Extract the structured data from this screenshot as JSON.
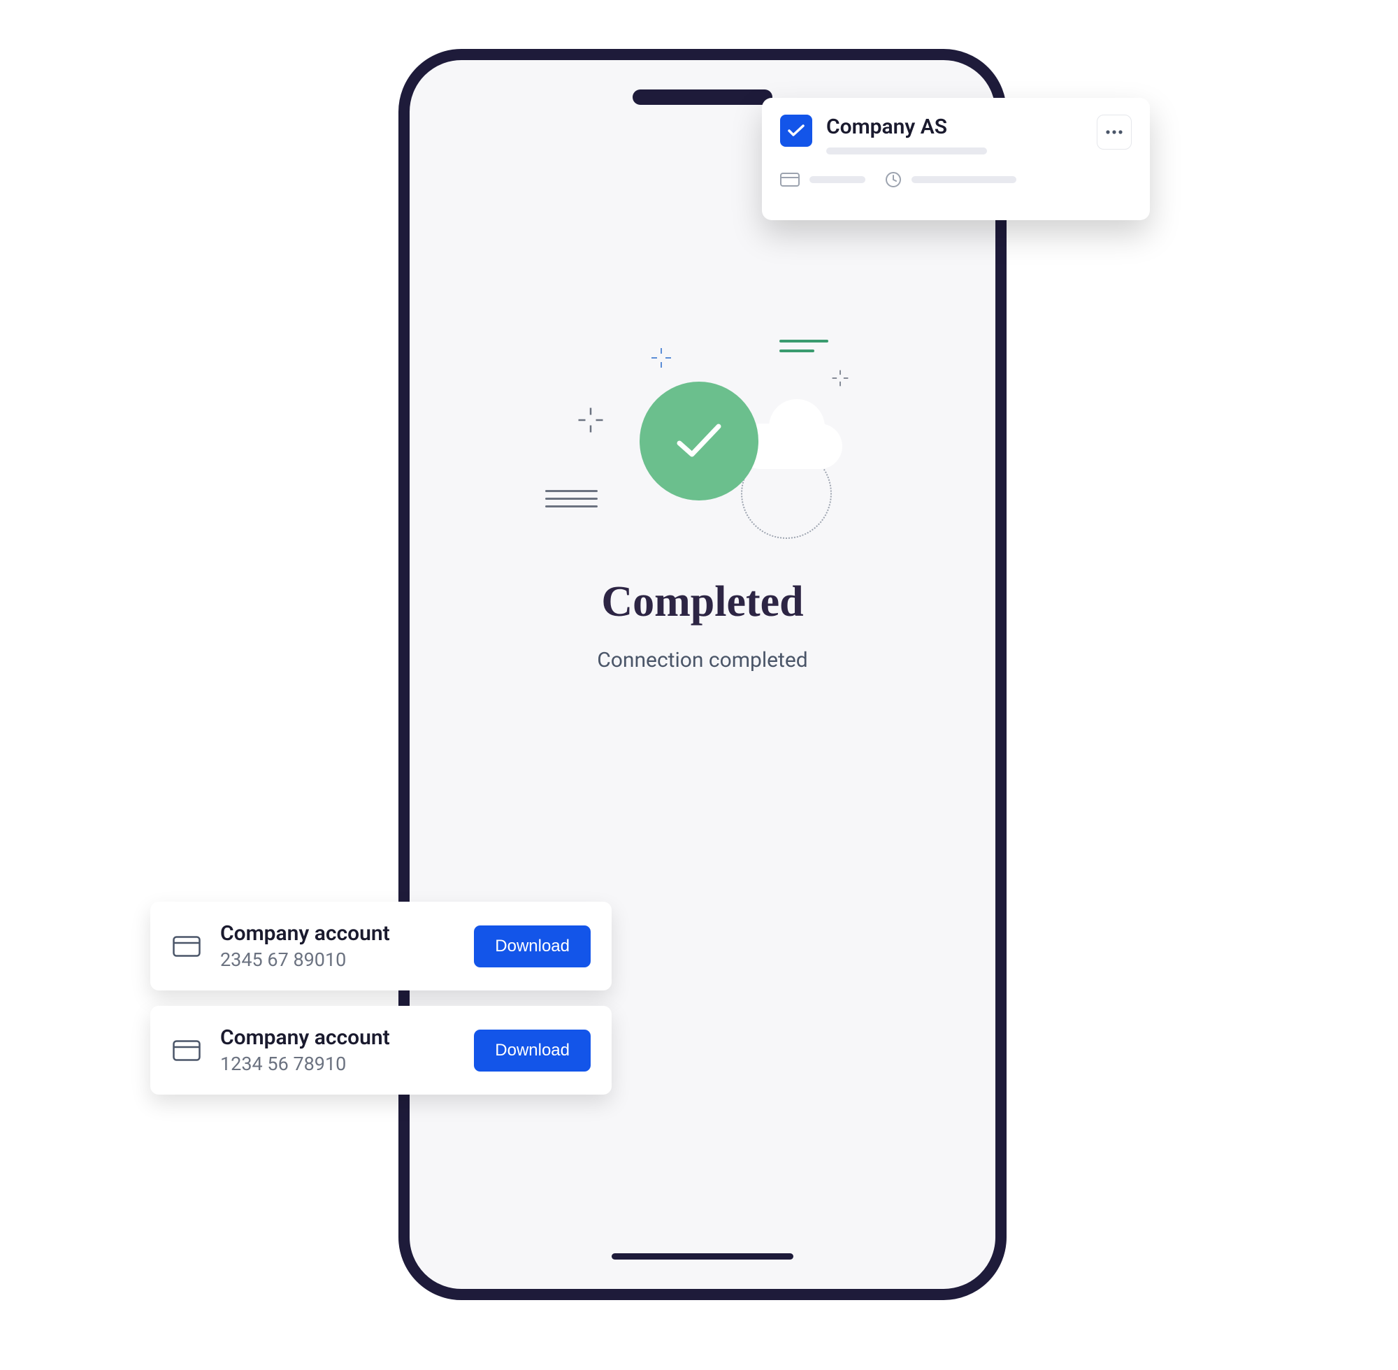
{
  "main": {
    "headline": "Completed",
    "subtitle": "Connection completed"
  },
  "companyCard": {
    "name": "Company AS"
  },
  "accounts": [
    {
      "title": "Company account",
      "number": "2345 67 89010",
      "action": "Download"
    },
    {
      "title": "Company account",
      "number": "1234 56 78910",
      "action": "Download"
    }
  ],
  "colors": {
    "primary": "#1355e9",
    "success": "#6bbf8d",
    "frame": "#1e1b3a"
  }
}
